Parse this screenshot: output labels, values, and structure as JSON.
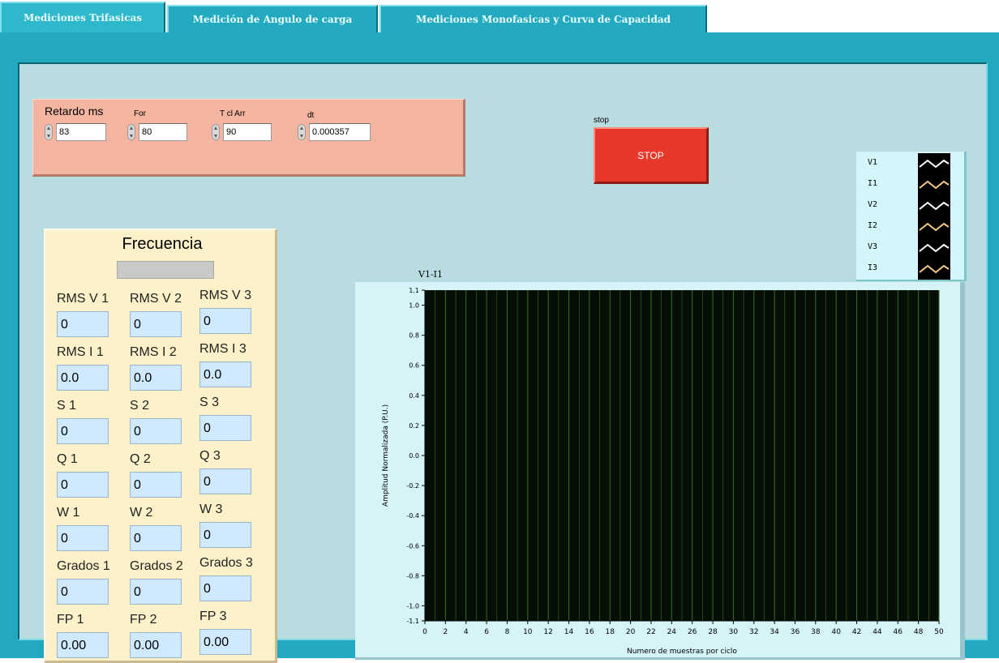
{
  "tabs": [
    {
      "label": "Mediciones Trifasicas",
      "active": true
    },
    {
      "label": "Medición de Angulo de carga",
      "active": false
    },
    {
      "label": "Mediciones Monofasicas y Curva de Capacidad",
      "active": false
    }
  ],
  "controls": {
    "retardo": {
      "label": "Retardo ms",
      "value": "83"
    },
    "for": {
      "label": "For",
      "value": "80"
    },
    "t_cl_arr": {
      "label": "T cl Arr",
      "value": "90"
    },
    "dt": {
      "label": "dt",
      "value": "0.000357"
    }
  },
  "stop": {
    "caption": "stop",
    "label": "STOP"
  },
  "frequency": {
    "title": "Frecuencia",
    "value": ""
  },
  "measurements": [
    {
      "labels": [
        "RMS V 1",
        "RMS V 2",
        "RMS V 3"
      ],
      "values": [
        "0",
        "0",
        "0"
      ]
    },
    {
      "labels": [
        "RMS I 1",
        "RMS I 2",
        "RMS I 3"
      ],
      "values": [
        "0.0",
        "0.0",
        "0.0"
      ]
    },
    {
      "labels": [
        "S 1",
        "S 2",
        "S 3"
      ],
      "values": [
        "0",
        "0",
        "0"
      ]
    },
    {
      "labels": [
        "Q 1",
        "Q 2",
        "Q 3"
      ],
      "values": [
        "0",
        "0",
        "0"
      ]
    },
    {
      "labels": [
        "W 1",
        "W 2",
        "W 3"
      ],
      "values": [
        "0",
        "0",
        "0"
      ]
    },
    {
      "labels": [
        "Grados 1",
        "Grados 2",
        "Grados 3"
      ],
      "values": [
        "0",
        "0",
        "0"
      ]
    },
    {
      "labels": [
        "FP 1",
        "FP 2",
        "FP 3"
      ],
      "values": [
        "0.00",
        "0.00",
        "0.00"
      ]
    }
  ],
  "legend": [
    {
      "name": "V1",
      "color": "#ffffff"
    },
    {
      "name": "I1",
      "color": "#f5c98a"
    },
    {
      "name": "V2",
      "color": "#ffffff"
    },
    {
      "name": "I2",
      "color": "#f5c98a"
    },
    {
      "name": "V3",
      "color": "#ffffff"
    },
    {
      "name": "I3",
      "color": "#f5c98a"
    }
  ],
  "graph": {
    "plot_name": "V1-I1",
    "xlabel": "Numero de muestras por ciclo",
    "ylabel": "Amplitud  Normalizada (P.U.)",
    "background": "#050f05",
    "gridline_color": "#3c6b2a",
    "xlim": [
      0,
      50
    ],
    "ylim": [
      -1.1,
      1.1
    ],
    "xticks": [
      "0",
      "2",
      "4",
      "6",
      "8",
      "10",
      "12",
      "14",
      "16",
      "18",
      "20",
      "22",
      "24",
      "26",
      "28",
      "30",
      "32",
      "34",
      "36",
      "38",
      "40",
      "42",
      "44",
      "46",
      "48",
      "50"
    ],
    "yticks": [
      "1.1",
      "1.0",
      "0.8",
      "0.6",
      "0.4",
      "0.2",
      "0.0",
      "-0.2",
      "-0.4",
      "-0.6",
      "-0.8",
      "-1.0",
      "-1.1"
    ]
  }
}
